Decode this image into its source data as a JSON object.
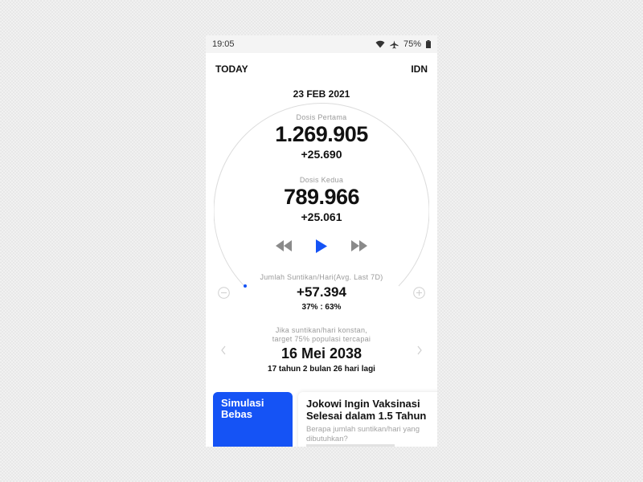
{
  "status_bar": {
    "time": "19:05",
    "battery": "75%",
    "icons": [
      "wifi-icon",
      "airplane-icon",
      "battery-icon"
    ]
  },
  "nav": {
    "left": "TODAY",
    "right": "IDN"
  },
  "dial": {
    "date": "23 FEB 2021",
    "first_dose_label": "Dosis Pertama",
    "first_dose_value": "1.269.905",
    "first_dose_delta": "+25.690",
    "second_dose_label": "Dosis Kedua",
    "second_dose_value": "789.966",
    "second_dose_delta": "+25.061"
  },
  "playback": {
    "icons": [
      "rewind-icon",
      "play-icon",
      "fast-forward-icon"
    ]
  },
  "avg": {
    "label": "Jumlah Suntikan/Hari(Avg. Last 7D)",
    "value": "+57.394",
    "ratio": "37% : 63%"
  },
  "target": {
    "line1": "Jika suntikan/hari konstan,",
    "line2": "target 75% populasi tercapai",
    "date": "16 Mei 2038",
    "remaining": "17 tahun 2 bulan 26 hari lagi"
  },
  "cards": [
    {
      "title": "Simulasi Bebas"
    },
    {
      "title": "Jokowi Ingin Vaksinasi Selesai dalam 1.5 Tahun",
      "subtitle": "Berapa jumlah suntikan/hari yang dibutuhkan?"
    }
  ],
  "colors": {
    "accent": "#1553f5",
    "text": "#111111",
    "muted": "#9a9a9a"
  }
}
